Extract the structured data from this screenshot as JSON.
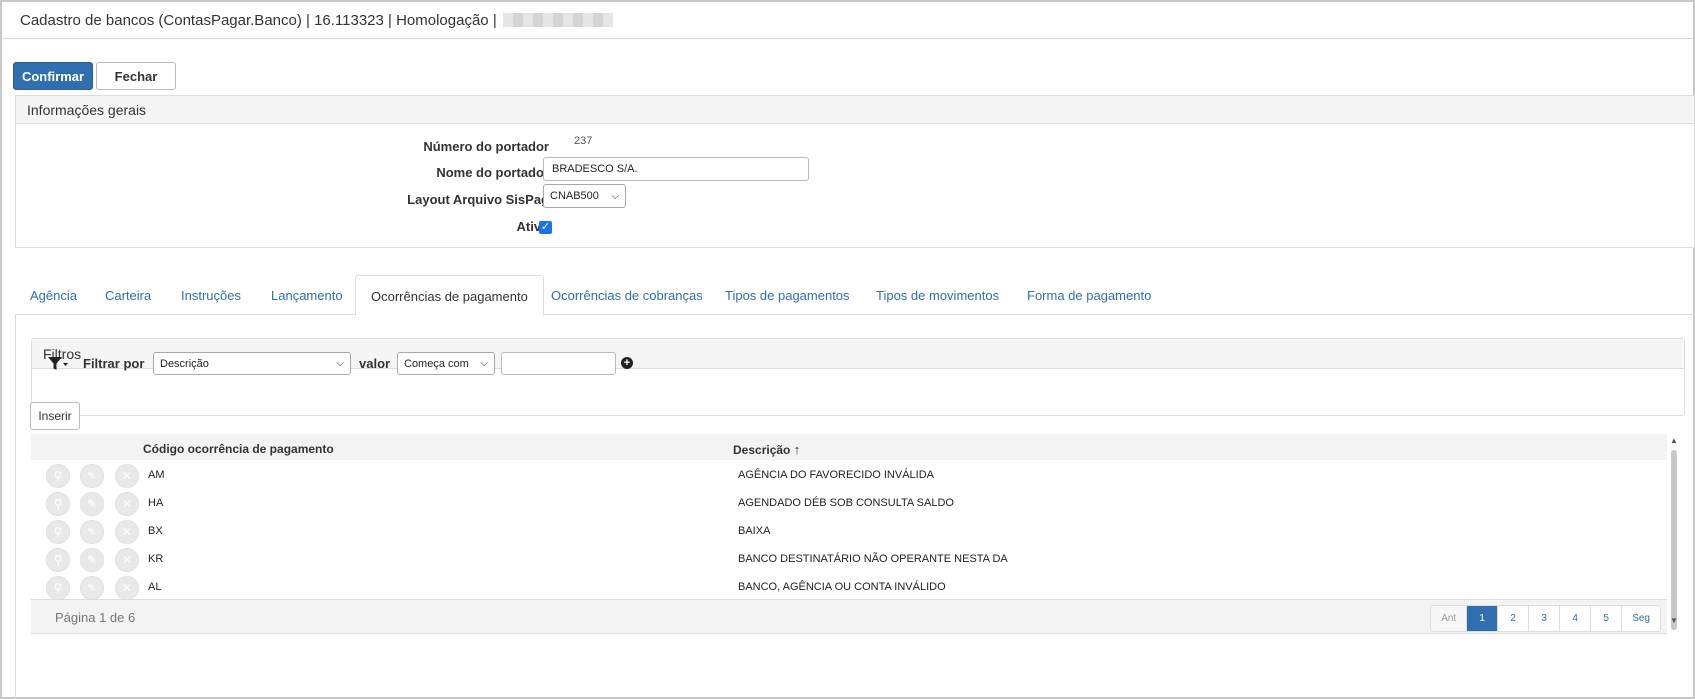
{
  "window": {
    "title": "Cadastro de bancos (ContasPagar.Banco) | 16.113323 | Homologação |"
  },
  "toolbar": {
    "confirm_label": "Confirmar",
    "close_label": "Fechar"
  },
  "general_info": {
    "heading": "Informações gerais",
    "number_label": "Número do portador",
    "number_value": "237",
    "name_label": "Nome do portador",
    "name_value": "BRADESCO S/A.",
    "layout_label": "Layout Arquivo SisPag",
    "layout_value": "CNAB500",
    "active_label": "Ativo",
    "active_checked": true
  },
  "tabs": [
    {
      "label": "Agência"
    },
    {
      "label": "Carteira"
    },
    {
      "label": "Instruções"
    },
    {
      "label": "Lançamento"
    },
    {
      "label": "Ocorrências de pagamento"
    },
    {
      "label": "Ocorrências de cobranças"
    },
    {
      "label": "Tipos de pagamentos"
    },
    {
      "label": "Tipos de movimentos"
    },
    {
      "label": "Forma de pagamento"
    }
  ],
  "filters": {
    "heading": "Filtros",
    "filter_by_label": "Filtrar por",
    "field_value": "Descrição",
    "value_label": "valor",
    "operator_value": "Começa com",
    "text_value": ""
  },
  "grid": {
    "insert_label": "Inserir",
    "columns": [
      "Código ocorrência de pagamento",
      "Descrição"
    ],
    "sort_glyph": "↑",
    "rows": [
      {
        "code": "AM",
        "desc": "AGÊNCIA DO FAVORECIDO INVÁLIDA"
      },
      {
        "code": "HA",
        "desc": "AGENDADO DÉB SOB CONSULTA SALDO"
      },
      {
        "code": "BX",
        "desc": "BAIXA"
      },
      {
        "code": "KR",
        "desc": "BANCO DESTINATÁRIO NÃO OPERANTE NESTA DA"
      },
      {
        "code": "AL",
        "desc": "BANCO, AGÊNCIA OU CONTA INVÁLIDO"
      }
    ]
  },
  "pager": {
    "info": "Página 1 de 6",
    "prev": "Ant",
    "pages": [
      "1",
      "2",
      "3",
      "4",
      "5"
    ],
    "next": "Seg"
  },
  "colors": {
    "primary": "#2f6fb0",
    "tab_link": "#2f6fb0",
    "required": "#cc0000"
  }
}
